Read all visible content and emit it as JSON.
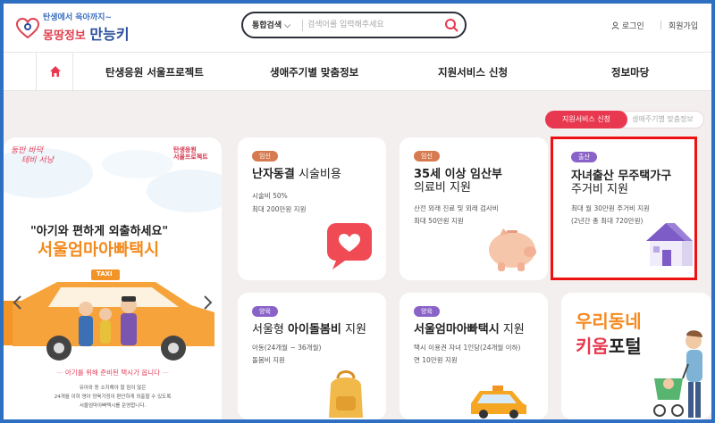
{
  "header": {
    "logo_sub": "탄생에서 육아까지~",
    "logo_main_a": "몽땅정보",
    "logo_main_b": "만능키",
    "search_select": "통합검색",
    "search_placeholder": "검색어를 입력해주세요",
    "login": "로그인",
    "signup": "회원가입"
  },
  "nav": {
    "items": [
      "탄생응원 서울프로젝트",
      "생애주기별 맞춤정보",
      "지원서비스 신청",
      "정보마당"
    ]
  },
  "toggle": {
    "active": "지원서비스 신청",
    "inactive": "생애주기별 맞춤정보"
  },
  "banner": {
    "tag_line1": "둥반 바덕",
    "tag_line2": "테비 서낭",
    "logo_line1": "탄생응원",
    "logo_line2": "서울프로젝트",
    "headline": "\"아기와 편하게 외출하세요\"",
    "title": "서울엄마아빠택시",
    "taxi_label": "TAXI",
    "footer": "아기를 위해 준비된 택시가 옵니다",
    "small_1": "유아와 동 소지해야 할 짐이 많은",
    "small_2": "24개월 이하 영아 양육가정이 편안하게 외출할 수 있도록",
    "small_3": "서울엄마아빠택시를 운영합니다."
  },
  "cards": [
    {
      "badge": "임신",
      "title_bold": "난자동결",
      "title_rest": "시술비용",
      "desc": [
        "시술비 50%",
        "최대 200만원 지원"
      ]
    },
    {
      "badge": "임신",
      "title_bold": "35세 이상 임산부",
      "title_line2": "의료비 지원",
      "desc": [
        "산전 외래 진료 및 외래 검사비",
        "최대 50만원 지원"
      ]
    },
    {
      "badge": "출산",
      "title_bold": "자녀출산 무주택가구",
      "title_line2": "주거비 지원",
      "desc": [
        "최대 월 30만원 주거비 지원",
        "(2년간 총 최대 720만원)"
      ]
    },
    {
      "badge": "양육",
      "title_rest": "서울형",
      "title_bold": "아이돌봄비",
      "title_tail": "지원",
      "desc": [
        "아동(24개월 ~ 36개월)",
        "돌봄비 지원"
      ]
    },
    {
      "badge": "양육",
      "title_bold": "서울엄마아빠택시",
      "title_tail": "지원",
      "desc": [
        "택시 이용권 자녀 1인당(24개월 이하)",
        "연 10만원 지원"
      ]
    }
  ],
  "kium": {
    "line1": "우리동네",
    "line2a": "키움",
    "line2b": "포털"
  },
  "colors": {
    "accent": "#e8384f",
    "nav_bg": "#ffffff",
    "main_bg": "#f4efef",
    "highlight_border": "#ee1111",
    "frame": "#2f6fc2"
  }
}
